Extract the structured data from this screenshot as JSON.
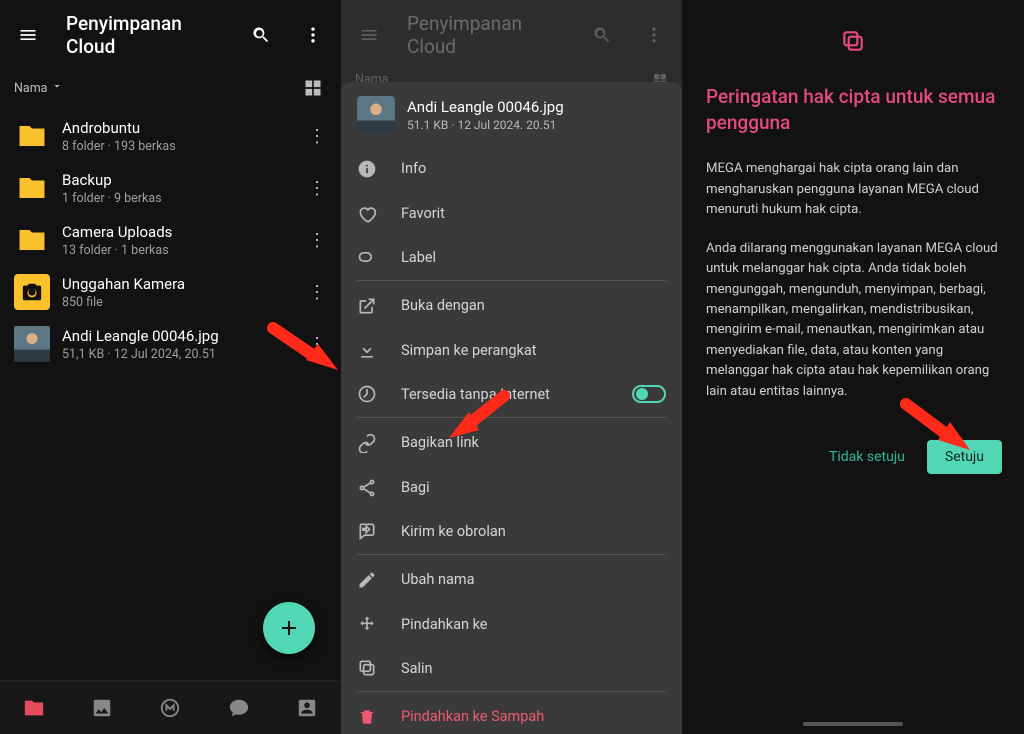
{
  "panel1": {
    "title": "Penyimpanan Cloud",
    "sort_label": "Nama",
    "rows": [
      {
        "type": "folder",
        "name": "Androbuntu",
        "sub": "8 folder · 193 berkas"
      },
      {
        "type": "folder",
        "name": "Backup",
        "sub": "1 folder · 9 berkas"
      },
      {
        "type": "folder",
        "name": "Camera Uploads",
        "sub": "13 folder · 1 berkas"
      },
      {
        "type": "cam",
        "name": "Unggahan Kamera",
        "sub": "850 file"
      },
      {
        "type": "image",
        "name": "Andi Leangle 00046.jpg",
        "sub": "51,1 KB · 12 Jul 2024, 20.51"
      }
    ]
  },
  "panel2": {
    "title": "Penyimpanan Cloud",
    "sort_label": "Nama",
    "file": {
      "name": "Andi Leangle 00046.jpg",
      "sub": "51.1 KB · 12 Jul 2024. 20.51"
    },
    "menu": {
      "info": "Info",
      "favorit": "Favorit",
      "label": "Label",
      "buka_dengan": "Buka dengan",
      "simpan": "Simpan ke perangkat",
      "offline": "Tersedia tanpa Internet",
      "bagikan_link": "Bagikan link",
      "bagi": "Bagi",
      "kirim_obrolan": "Kirim ke obrolan",
      "ubah_nama": "Ubah nama",
      "pindahkan_ke": "Pindahkan ke",
      "salin": "Salin",
      "sampah": "Pindahkan ke Sampah"
    }
  },
  "panel3": {
    "heading": "Peringatan hak cipta untuk semua pengguna",
    "para1": "MEGA menghargai hak cipta orang lain dan mengharuskan pengguna layanan MEGA cloud menuruti hukum hak cipta.",
    "para2": "Anda dilarang menggunakan layanan MEGA cloud untuk melanggar hak cipta. Anda tidak boleh mengunggah, mengunduh, menyimpan, berbagi, menampilkan, mengalirkan, mendistribusikan, mengirim e-mail, menautkan, mengirimkan atau menyediakan file, data, atau konten yang melanggar hak cipta atau hak kepemilikan orang lain atau entitas lainnya.",
    "disagree": "Tidak setuju",
    "agree": "Setuju"
  }
}
